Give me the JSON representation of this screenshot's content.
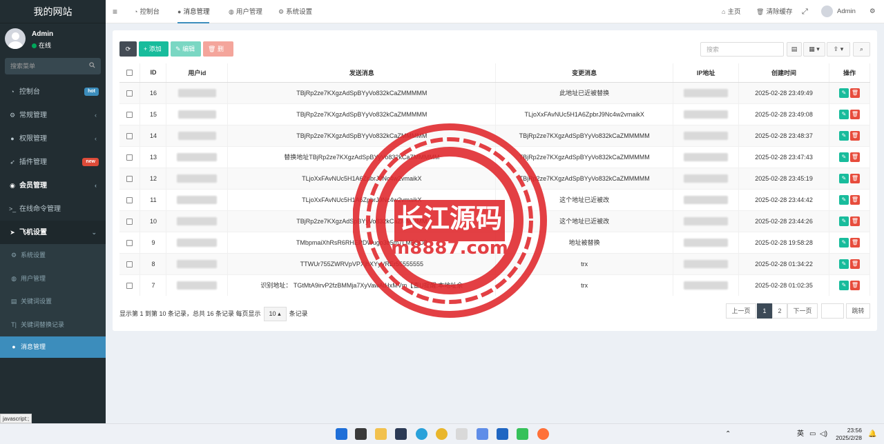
{
  "sidebar": {
    "logo": "我的网站",
    "user": {
      "name": "Admin",
      "status": "在线"
    },
    "search_placeholder": "搜索菜单",
    "menu": [
      {
        "label": "控制台",
        "icon": "dashboard-icon",
        "badge": "hot"
      },
      {
        "label": "常规管理",
        "icon": "cogs-icon"
      },
      {
        "label": "权限管理",
        "icon": "group-icon"
      },
      {
        "label": "插件管理",
        "icon": "rocket-icon",
        "badge": "new"
      },
      {
        "label": "会员管理",
        "icon": "user-circle-icon"
      },
      {
        "label": "在线命令管理",
        "icon": "terminal-icon"
      },
      {
        "label": "飞机设置",
        "icon": "telegram-icon"
      }
    ],
    "submenu": [
      {
        "label": "系统设置",
        "icon": "gear-icon"
      },
      {
        "label": "用户管理",
        "icon": "user-icon"
      },
      {
        "label": "关键词设置",
        "icon": "file-icon"
      },
      {
        "label": "关键词替换记录",
        "icon": "text-icon"
      },
      {
        "label": "消息管理",
        "icon": "comment-icon"
      }
    ]
  },
  "topbar": {
    "tabs": [
      {
        "label": "控制台",
        "icon": "dashboard-icon"
      },
      {
        "label": "消息管理",
        "icon": "comment-icon"
      },
      {
        "label": "用户管理",
        "icon": "user-icon"
      },
      {
        "label": "系统设置",
        "icon": "gear-icon"
      }
    ],
    "home": "主页",
    "clear_cache": "清除缓存",
    "admin": "Admin"
  },
  "toolbar": {
    "add": "添加",
    "edit": "编辑",
    "delete": "删除",
    "search_placeholder": "搜索"
  },
  "table": {
    "headers": [
      "ID",
      "用户id",
      "发送消息",
      "变更消息",
      "IP地址",
      "创建时间",
      "操作"
    ],
    "rows": [
      {
        "id": "16",
        "send": "TBjRp2ze7KXgzAdSpBYyVo832kCaZMMMMM",
        "change": "此地址已近被替换",
        "time": "2025-02-28 23:49:49"
      },
      {
        "id": "15",
        "send": "TBjRp2ze7KXgzAdSpBYyVo832kCaZMMMMM",
        "change": "TLjoXxFAvNUc5H1A6ZpbrJ9Nc4w2vmaikX",
        "time": "2025-02-28 23:49:08"
      },
      {
        "id": "14",
        "send": "TBjRp2ze7KXgzAdSpBYyVo832kCaZMMMMM",
        "change": "TBjRp2ze7KXgzAdSpBYyVo832kCaZMMMMM",
        "time": "2025-02-28 23:48:37"
      },
      {
        "id": "13",
        "send": "替换地址TBjRp2ze7KXgzAdSpBYyVo832kCaZMMMMM",
        "change": "TBjRp2ze7KXgzAdSpBYyVo832kCaZMMMMM",
        "time": "2025-02-28 23:47:43"
      },
      {
        "id": "12",
        "send": "TLjoXxFAvNUc5H1A6ZpbrJ9Nc4w2vmaikX",
        "change": "TBjRp2ze7KXgzAdSpBYyVo832kCaZMMMMM",
        "time": "2025-02-28 23:45:19"
      },
      {
        "id": "11",
        "send": "TLjoXxFAvNUc5H1A6ZpbrJ9Nc4w2vmaikX",
        "change": "这个地址已近被改",
        "time": "2025-02-28 23:44:42"
      },
      {
        "id": "10",
        "send": "TBjRp2ze7KXgzAdSpBYyVo832kCaZMMMMM",
        "change": "这个地址已近被改",
        "time": "2025-02-28 23:44:26"
      },
      {
        "id": "9",
        "send": "TMbpmaiXhRsR6RHEPDWugo3b5m7LM5OO9",
        "change": "地址被替换",
        "time": "2025-02-28 19:58:28"
      },
      {
        "id": "8",
        "send": "TTWUr755ZWRVpVPXjhXYyVREr55555555",
        "change": "trx",
        "time": "2025-02-28 01:34:22"
      },
      {
        "id": "7",
        "send": "识别地址：  TGtMtA9irvP2fzBMMja7XyVawAtHxMVm【查U提醒:本地址余",
        "change": "trx",
        "time": "2025-02-28 01:02:35"
      }
    ]
  },
  "pagination": {
    "summary": "显示第 1 到第 10 条记录，总共 16 条记录 每页显示",
    "page_size": "10",
    "suffix": "条记录",
    "prev": "上一页",
    "pages": [
      "1",
      "2"
    ],
    "next": "下一页",
    "jump": "跳转"
  },
  "watermark": {
    "title": "长江源码",
    "url": "m8887.com",
    "color": "#e0262b"
  },
  "status_bar": "javascript:;",
  "taskbar": {
    "lang": "英",
    "time": "23:56",
    "date": "2025/2/28"
  },
  "colors": {
    "sidebar": "#222d32",
    "accent": "#3c8dbc",
    "success": "#18bc9c",
    "danger": "#e74c3c"
  }
}
